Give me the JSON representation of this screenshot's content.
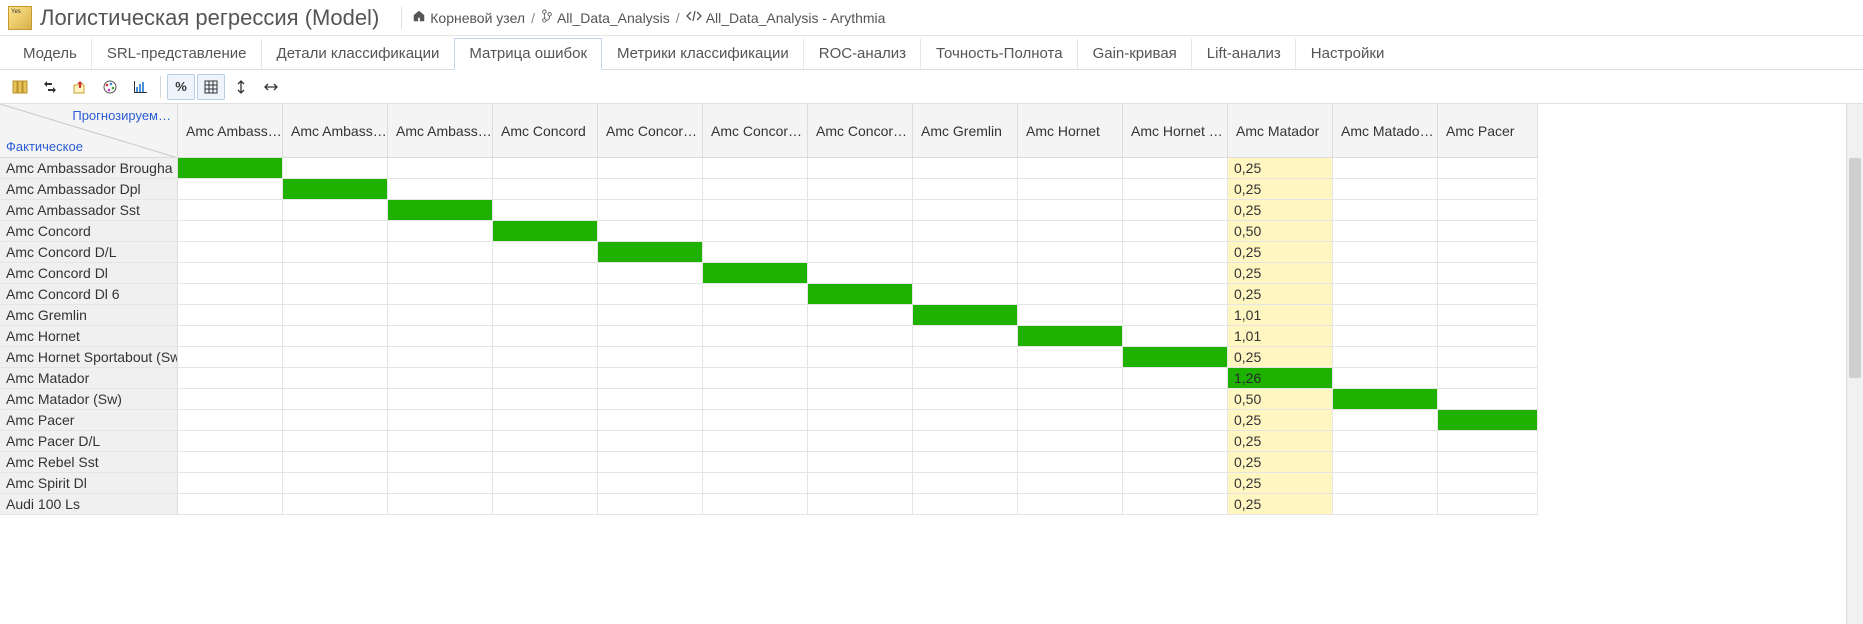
{
  "header": {
    "title": "Логистическая регрессия (Model)",
    "breadcrumb": [
      {
        "icon": "home",
        "label": "Корневой узел"
      },
      {
        "icon": "branch",
        "label": "All_Data_Analysis"
      },
      {
        "icon": "code",
        "label": "All_Data_Analysis - Arythmia"
      }
    ]
  },
  "tabs": [
    {
      "id": "model",
      "label": "Модель"
    },
    {
      "id": "srl",
      "label": "SRL-представление"
    },
    {
      "id": "details",
      "label": "Детали классификации"
    },
    {
      "id": "confusion",
      "label": "Матрица ошибок",
      "active": true
    },
    {
      "id": "metrics",
      "label": "Метрики классификации"
    },
    {
      "id": "roc",
      "label": "ROC-анализ"
    },
    {
      "id": "pr",
      "label": "Точность-Полнота"
    },
    {
      "id": "gain",
      "label": "Gain-кривая"
    },
    {
      "id": "lift",
      "label": "Lift-анализ"
    },
    {
      "id": "settings",
      "label": "Настройки"
    }
  ],
  "toolbar": {
    "buttons": [
      {
        "name": "columns-icon",
        "active": false
      },
      {
        "name": "swap-icon",
        "active": false
      },
      {
        "name": "export-icon",
        "active": false
      },
      {
        "name": "palette-icon",
        "active": false
      },
      {
        "name": "chart-icon",
        "active": false
      }
    ],
    "buttons2": [
      {
        "name": "percent-icon",
        "active": true
      },
      {
        "name": "grid-icon",
        "active": true
      },
      {
        "name": "vertical-icon",
        "active": false
      },
      {
        "name": "horizontal-icon",
        "active": false
      }
    ]
  },
  "matrix": {
    "corner_predicted": "Прогнозируем…",
    "corner_actual": "Фактическое",
    "columns": [
      "Amc Ambass…",
      "Amc Ambass…",
      "Amc Ambass…",
      "Amc Concord",
      "Amc Concor…",
      "Amc Concor…",
      "Amc Concor…",
      "Amc Gremlin",
      "Amc Hornet",
      "Amc Hornet …",
      "Amc Matador",
      "Amc Matado…",
      "Amc Pacer"
    ],
    "rows": [
      "Amc Ambassador Brougha",
      "Amc Ambassador Dpl",
      "Amc Ambassador Sst",
      "Amc Concord",
      "Amc Concord D/L",
      "Amc Concord Dl",
      "Amc Concord Dl 6",
      "Amc Gremlin",
      "Amc Hornet",
      "Amc Hornet Sportabout (Sw",
      "Amc Matador",
      "Amc Matador (Sw)",
      "Amc Pacer",
      "Amc Pacer D/L",
      "Amc Rebel Sst",
      "Amc Spirit Dl",
      "Audi 100 Ls"
    ],
    "cells": [
      {
        "r": 0,
        "c": 0,
        "cls": "green"
      },
      {
        "r": 0,
        "c": 10,
        "cls": "yellow",
        "v": "0,25"
      },
      {
        "r": 1,
        "c": 1,
        "cls": "green"
      },
      {
        "r": 1,
        "c": 10,
        "cls": "yellow",
        "v": "0,25"
      },
      {
        "r": 2,
        "c": 2,
        "cls": "green"
      },
      {
        "r": 2,
        "c": 10,
        "cls": "yellow",
        "v": "0,25"
      },
      {
        "r": 3,
        "c": 3,
        "cls": "green"
      },
      {
        "r": 3,
        "c": 10,
        "cls": "yellow",
        "v": "0,50"
      },
      {
        "r": 4,
        "c": 4,
        "cls": "green"
      },
      {
        "r": 4,
        "c": 10,
        "cls": "yellow",
        "v": "0,25"
      },
      {
        "r": 5,
        "c": 5,
        "cls": "green"
      },
      {
        "r": 5,
        "c": 10,
        "cls": "yellow",
        "v": "0,25"
      },
      {
        "r": 6,
        "c": 6,
        "cls": "green"
      },
      {
        "r": 6,
        "c": 10,
        "cls": "yellow",
        "v": "0,25"
      },
      {
        "r": 7,
        "c": 7,
        "cls": "green"
      },
      {
        "r": 7,
        "c": 10,
        "cls": "yellow",
        "v": "1,01"
      },
      {
        "r": 8,
        "c": 8,
        "cls": "green"
      },
      {
        "r": 8,
        "c": 10,
        "cls": "yellow",
        "v": "1,01"
      },
      {
        "r": 9,
        "c": 9,
        "cls": "green"
      },
      {
        "r": 9,
        "c": 10,
        "cls": "yellow",
        "v": "0,25"
      },
      {
        "r": 10,
        "c": 10,
        "cls": "greenval",
        "v": "1,26"
      },
      {
        "r": 11,
        "c": 10,
        "cls": "yellow",
        "v": "0,50"
      },
      {
        "r": 11,
        "c": 11,
        "cls": "green"
      },
      {
        "r": 12,
        "c": 10,
        "cls": "yellow",
        "v": "0,25"
      },
      {
        "r": 12,
        "c": 12,
        "cls": "green"
      },
      {
        "r": 13,
        "c": 10,
        "cls": "yellow",
        "v": "0,25"
      },
      {
        "r": 13,
        "c": 13,
        "cls": "green",
        "partial": true
      },
      {
        "r": 14,
        "c": 10,
        "cls": "yellow",
        "v": "0,25"
      },
      {
        "r": 15,
        "c": 10,
        "cls": "yellow",
        "v": "0,25"
      },
      {
        "r": 16,
        "c": 10,
        "cls": "yellow",
        "v": "0,25"
      }
    ]
  },
  "chart_data": {
    "type": "table",
    "title": "Confusion matrix (percent-highlighted column: Amc Matador)",
    "rows": [
      "Amc Ambassador Brougham",
      "Amc Ambassador Dpl",
      "Amc Ambassador Sst",
      "Amc Concord",
      "Amc Concord D/L",
      "Amc Concord Dl",
      "Amc Concord Dl 6",
      "Amc Gremlin",
      "Amc Hornet",
      "Amc Hornet Sportabout (Sw)",
      "Amc Matador",
      "Amc Matador (Sw)",
      "Amc Pacer",
      "Amc Pacer D/L",
      "Amc Rebel Sst",
      "Amc Spirit Dl",
      "Audi 100 Ls"
    ],
    "highlight_column": "Amc Matador",
    "values_in_highlight_column": [
      0.25,
      0.25,
      0.25,
      0.5,
      0.25,
      0.25,
      0.25,
      1.01,
      1.01,
      0.25,
      1.26,
      0.5,
      0.25,
      0.25,
      0.25,
      0.25,
      0.25
    ],
    "diagonal_correct": true
  }
}
